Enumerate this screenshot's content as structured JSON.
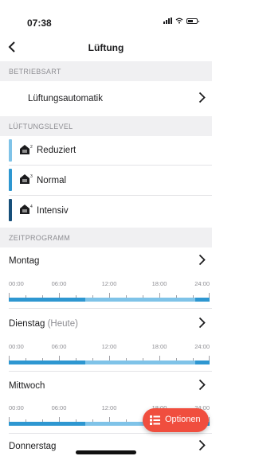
{
  "status_bar": {
    "time": "07:38"
  },
  "header": {
    "title": "Lüftung"
  },
  "betriebsart": {
    "section_title": "BETRIEBSART",
    "value": "Lüftungsautomatik"
  },
  "lueftungslevel": {
    "section_title": "LÜFTUNGSLEVEL",
    "items": [
      {
        "label": "Reduziert",
        "level": "2",
        "color": "#7fc3e8"
      },
      {
        "label": "Normal",
        "level": "3",
        "color": "#2e97d1"
      },
      {
        "label": "Intensiv",
        "level": "4",
        "color": "#174f7a"
      }
    ]
  },
  "zeitprogramm": {
    "section_title": "ZEITPROGRAMM",
    "time_labels": [
      "00:00",
      "06:00",
      "12:00",
      "18:00",
      "24:00"
    ],
    "days": [
      {
        "name": "Montag",
        "suffix": ""
      },
      {
        "name": "Dienstag",
        "suffix": "(Heute)"
      },
      {
        "name": "Mittwoch",
        "suffix": ""
      },
      {
        "name": "Donnerstag",
        "suffix": ""
      }
    ]
  },
  "fab": {
    "label": "Optionen",
    "color": "#f04e3e"
  }
}
